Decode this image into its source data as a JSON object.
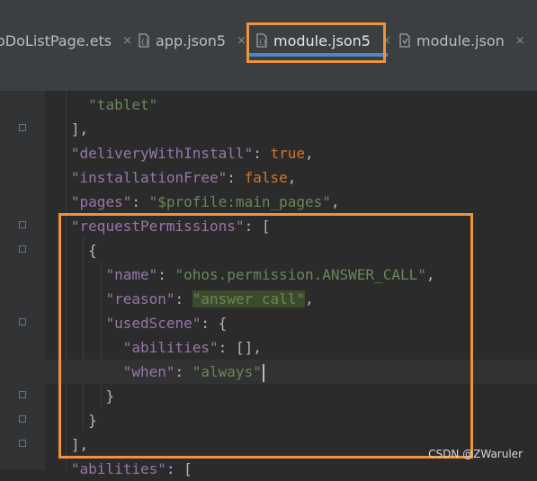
{
  "tabs": [
    {
      "label": "oDoListPage.ets",
      "icon": "ets-file-icon"
    },
    {
      "label": "app.json5",
      "icon": "json5-file-icon"
    },
    {
      "label": "module.json5",
      "icon": "json5-file-icon",
      "active": true
    },
    {
      "label": "module.json",
      "icon": "json-file-icon"
    }
  ],
  "close_glyph": "×",
  "code": {
    "l1_str": "\"tablet\"",
    "l2_punc": "],",
    "l3_key": "\"deliveryWithInstall\"",
    "l3_sep": ": ",
    "l3_val": "true",
    "l3_end": ",",
    "l4_key": "\"installationFree\"",
    "l4_sep": ": ",
    "l4_val": "false",
    "l4_end": ",",
    "l5_key": "\"pages\"",
    "l5_sep": ": ",
    "l5_val": "\"$profile:main_pages\"",
    "l5_end": ",",
    "l6_key": "\"requestPermissions\"",
    "l6_sep": ": [",
    "l7_punc": "{",
    "l8_key": "\"name\"",
    "l8_sep": ": ",
    "l8_val": "\"ohos.permission.ANSWER_CALL\"",
    "l8_end": ",",
    "l9_key": "\"reason\"",
    "l9_sep": ": ",
    "l9_val": "\"answer call\"",
    "l9_end": ",",
    "l10_key": "\"usedScene\"",
    "l10_sep": ": {",
    "l11_key": "\"abilities\"",
    "l11_sep": ": [],",
    "l12_key": "\"when\"",
    "l12_sep": ": ",
    "l12_val": "\"always\"",
    "l13_punc": "}",
    "l14_punc": "}",
    "l15_punc": "],",
    "l16_key": "\"abilities\"",
    "l16_sep": ": ["
  },
  "watermark": "CSDN @ZWaruler",
  "colors": {
    "highlight_box": "#f0923a",
    "active_tab_underline": "#4a88c7"
  }
}
